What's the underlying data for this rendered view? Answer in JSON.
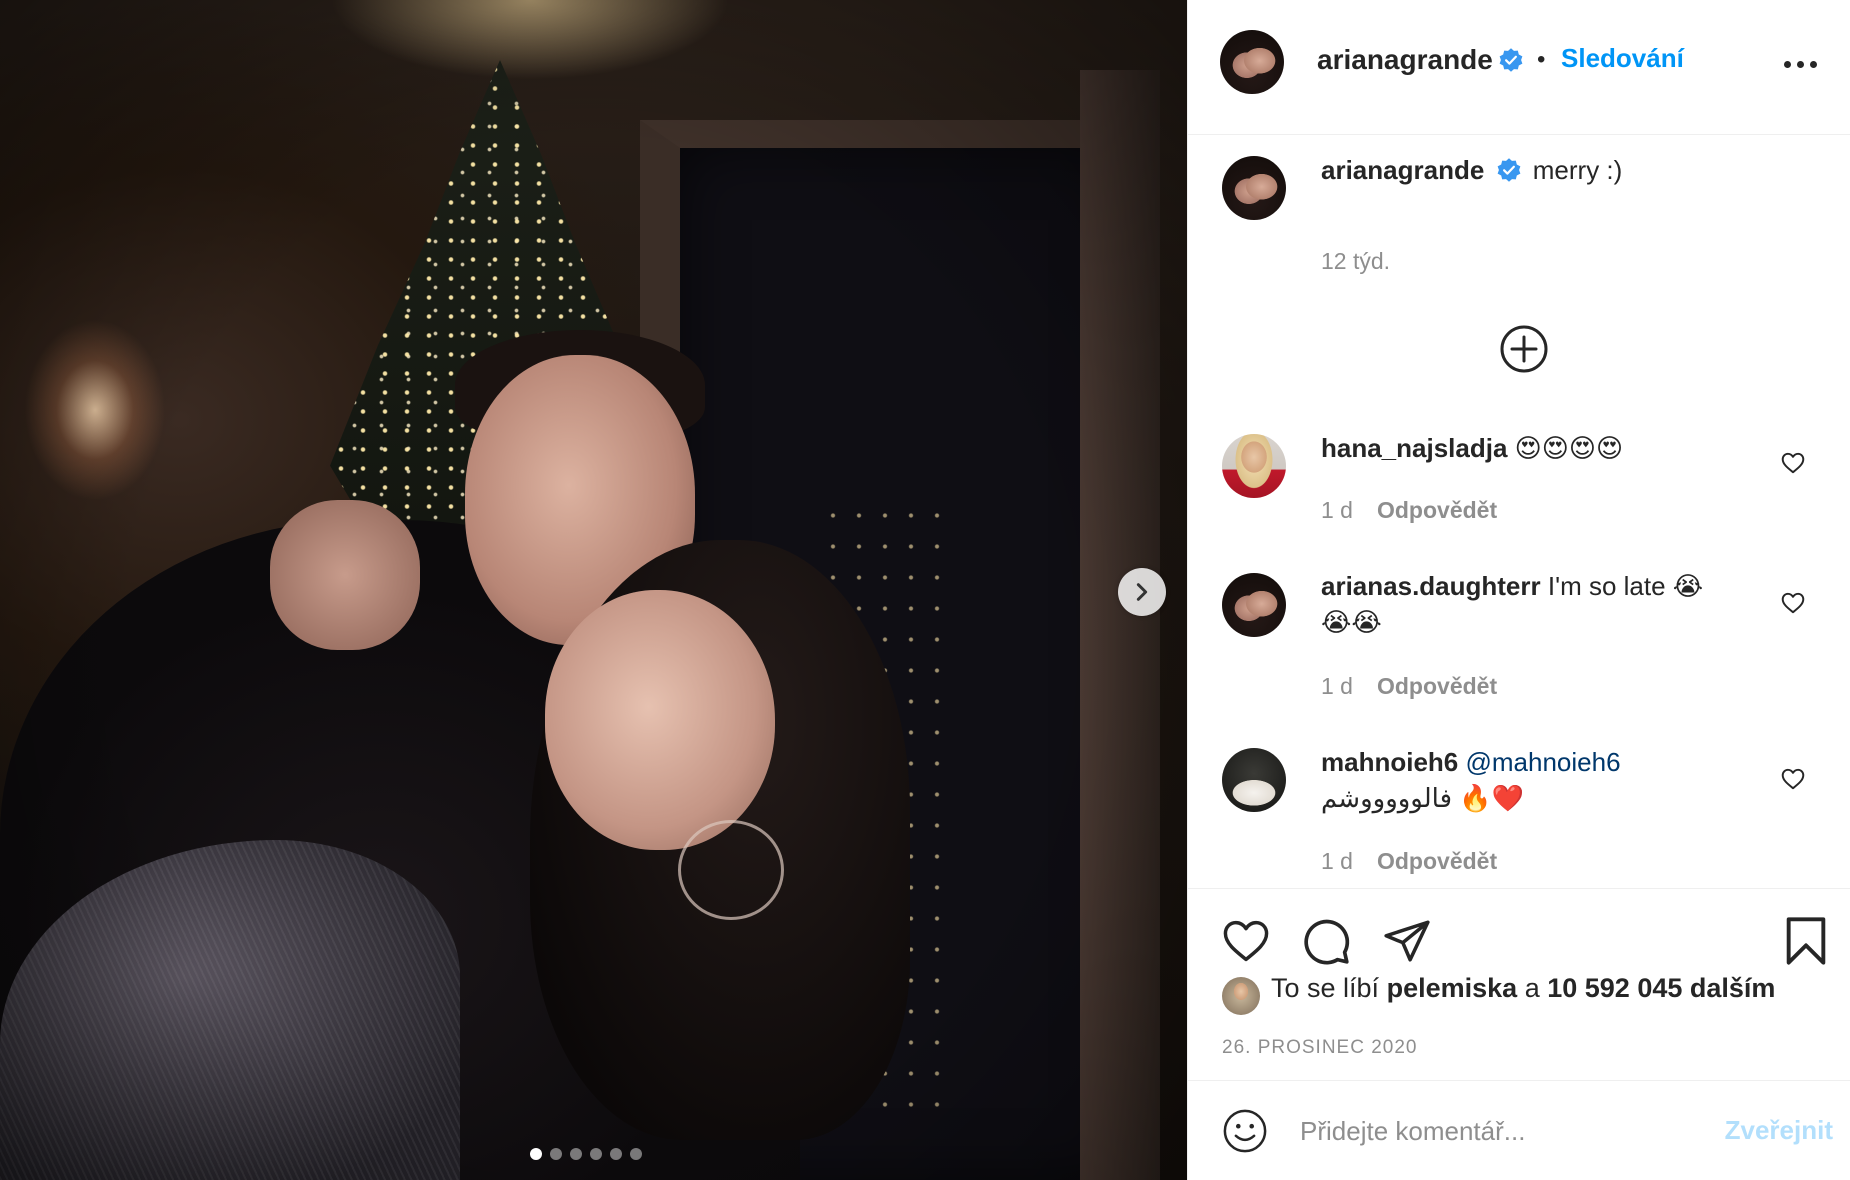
{
  "post": {
    "author": "arianagrande",
    "follow_dot": "•",
    "follow_label": "Sledování",
    "caption_author": "arianagrande",
    "caption_text": "merry :)",
    "caption_time": "12 týd.",
    "slide_count": 6,
    "active_slide": 1
  },
  "comments": [
    {
      "user": "hana_najsladja",
      "text": "😍😍😍😍",
      "time": "1 d",
      "reply": "Odpovědět"
    },
    {
      "user": "arianas.daughterr",
      "text": "I'm so late 😭",
      "text2": "😭😭",
      "time": "1 d",
      "reply": "Odpovědět"
    },
    {
      "user": "mahnoieh6",
      "mention": "@mahnoieh6",
      "text": "فالوووووشم 🔥❤️",
      "time": "1 d",
      "reply": "Odpovědět"
    }
  ],
  "likes": {
    "prefix": "To se líbí",
    "user": "pelemiska",
    "middle": "a",
    "count": "10 592 045 dalším"
  },
  "date": "26. PROSINEC 2020",
  "add_comment": {
    "placeholder": "Přidejte komentář...",
    "post_label": "Zveřejnit"
  },
  "colors": {
    "accent": "#0095f6",
    "verified": "#3897f0",
    "post_disabled": "#b2dffc",
    "muted": "#8e8e8e"
  },
  "icons": [
    "next-arrow-icon",
    "verified-badge-icon",
    "more-icon",
    "add-circle-icon",
    "heart-icon",
    "comment-icon",
    "share-icon",
    "bookmark-icon",
    "emoji-icon"
  ]
}
